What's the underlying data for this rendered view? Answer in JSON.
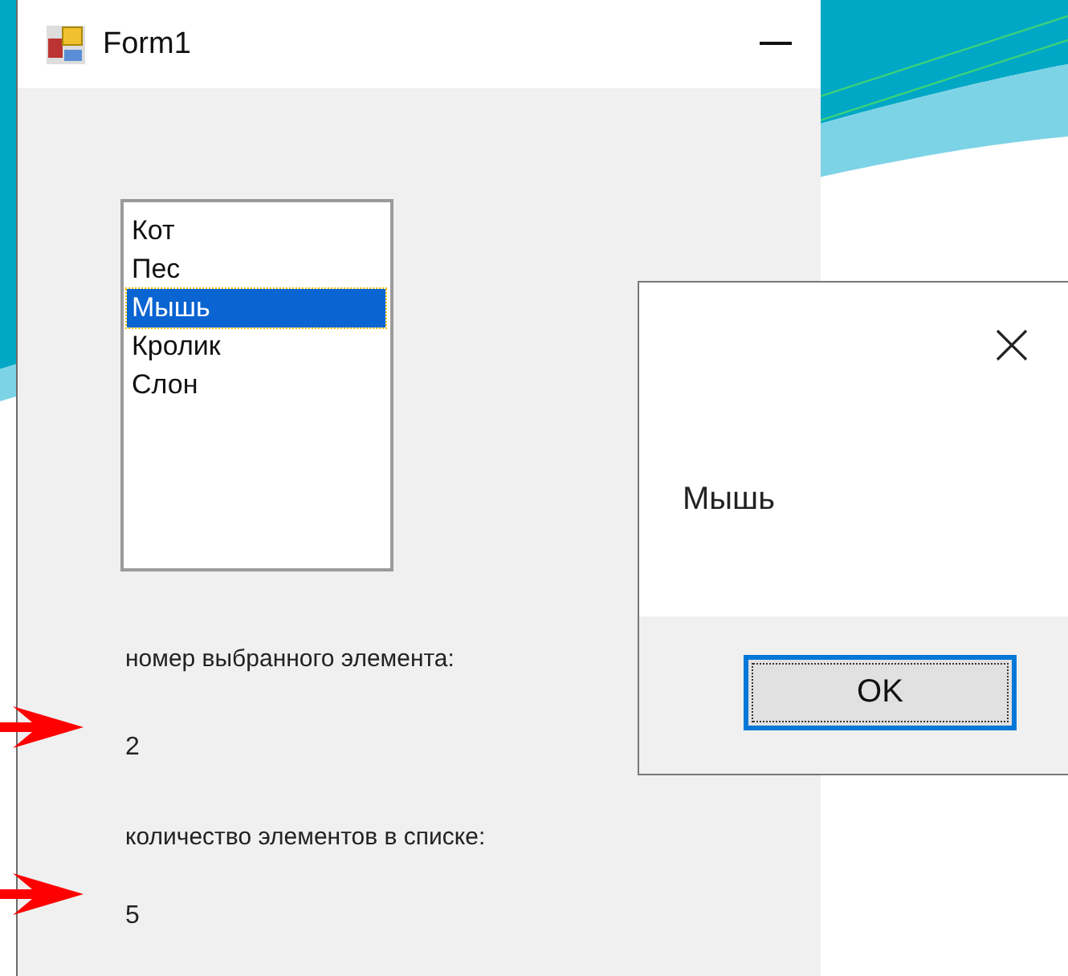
{
  "form": {
    "title": "Form1",
    "list_items": [
      {
        "label": "Кот",
        "selected": false
      },
      {
        "label": "Пес",
        "selected": false
      },
      {
        "label": "Мышь",
        "selected": true
      },
      {
        "label": "Кролик",
        "selected": false
      },
      {
        "label": "Слон",
        "selected": false
      }
    ],
    "index_label": "номер выбранного элемента:",
    "index_value": "2",
    "count_label": "количество элементов в списке:",
    "count_value": "5"
  },
  "message_box": {
    "text": "Мышь",
    "button": "OK"
  }
}
